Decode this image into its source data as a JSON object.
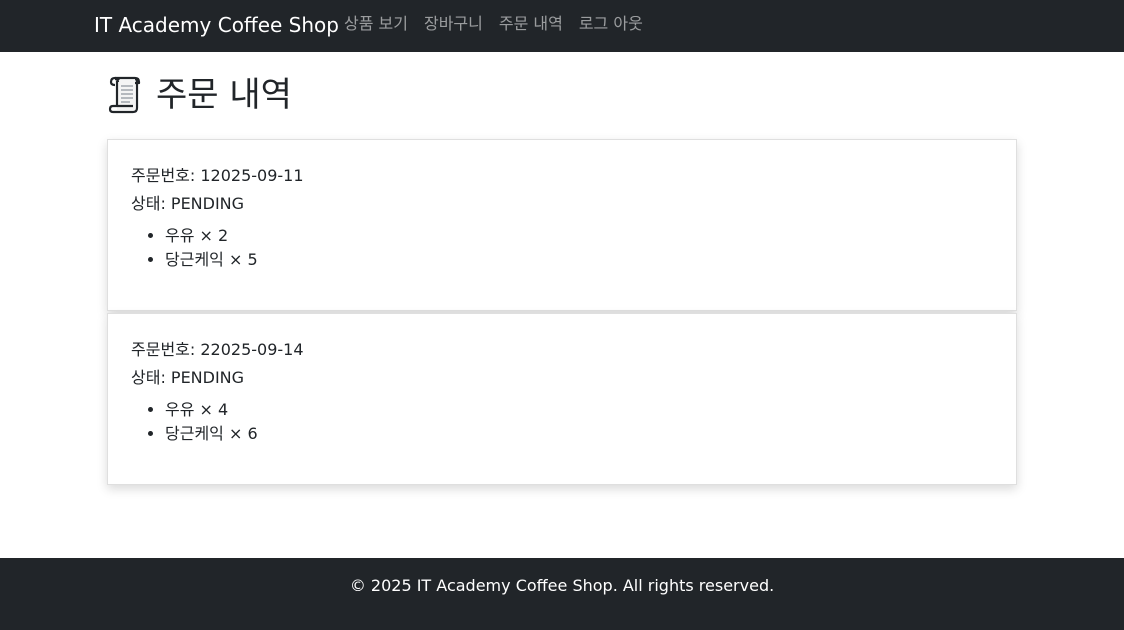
{
  "nav": {
    "brand": "IT Academy Coffee Shop",
    "links": [
      {
        "label": "상품 보기"
      },
      {
        "label": "장바구니"
      },
      {
        "label": "주문 내역"
      },
      {
        "label": "로그 아웃"
      }
    ]
  },
  "page": {
    "icon": "scroll-icon",
    "title": "주문 내역"
  },
  "orders": [
    {
      "number_line": "주문번호: 12025-09-11",
      "status_line": "상태: PENDING",
      "items": [
        {
          "text": "우유 × 2"
        },
        {
          "text": "당근케익 × 5"
        }
      ]
    },
    {
      "number_line": "주문번호: 22025-09-14",
      "status_line": "상태: PENDING",
      "items": [
        {
          "text": "우유 × 4"
        },
        {
          "text": "당근케익 × 6"
        }
      ]
    }
  ],
  "footer": {
    "text": "© 2025 IT Academy Coffee Shop. All rights reserved."
  },
  "colors": {
    "navbar_bg": "#212529",
    "page_bg": "#ffffff",
    "nav_link": "#8c8f93"
  }
}
